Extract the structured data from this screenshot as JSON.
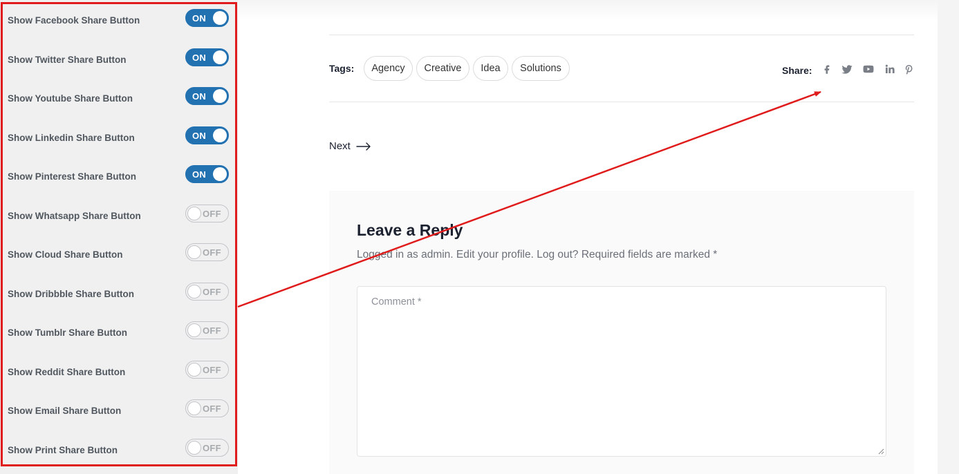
{
  "settings": [
    {
      "label": "Show Facebook Share Button",
      "state": "ON",
      "on": true
    },
    {
      "label": "Show Twitter Share Button",
      "state": "ON",
      "on": true
    },
    {
      "label": "Show Youtube Share Button",
      "state": "ON",
      "on": true
    },
    {
      "label": "Show Linkedin Share Button",
      "state": "ON",
      "on": true
    },
    {
      "label": "Show Pinterest Share Button",
      "state": "ON",
      "on": true
    },
    {
      "label": "Show Whatsapp Share Button",
      "state": "OFF",
      "on": false
    },
    {
      "label": "Show Cloud Share Button",
      "state": "OFF",
      "on": false
    },
    {
      "label": "Show Dribbble Share Button",
      "state": "OFF",
      "on": false
    },
    {
      "label": "Show Tumblr Share Button",
      "state": "OFF",
      "on": false
    },
    {
      "label": "Show Reddit Share Button",
      "state": "OFF",
      "on": false
    },
    {
      "label": "Show Email Share Button",
      "state": "OFF",
      "on": false
    },
    {
      "label": "Show Print Share Button",
      "state": "OFF",
      "on": false
    }
  ],
  "post": {
    "tags_label": "Tags:",
    "tags": [
      "Agency",
      "Creative",
      "Idea",
      "Solutions"
    ],
    "share_label": "Share:",
    "share_icons": [
      "facebook-icon",
      "twitter-icon",
      "youtube-icon",
      "linkedin-icon",
      "pinterest-icon"
    ],
    "next_label": "Next"
  },
  "reply": {
    "title": "Leave a Reply",
    "meta": "Logged in as admin. Edit your profile. Log out? Required fields are marked *",
    "comment_placeholder": "Comment *"
  },
  "colors": {
    "toggle_on": "#2271b1",
    "highlight": "#e01b1b",
    "icon": "#7a7f87"
  }
}
